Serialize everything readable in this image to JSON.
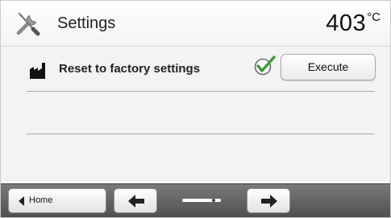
{
  "header": {
    "title": "Settings",
    "temperature_value": "403",
    "temperature_unit": "°C",
    "icon": "wrench-screwdriver-icon"
  },
  "settings_row": {
    "icon": "factory-icon",
    "label": "Reset to factory settings",
    "status_icon": "checkmark-icon",
    "execute_label": "Execute"
  },
  "footer": {
    "home_label": "Home",
    "prev_icon": "arrow-left-icon",
    "next_icon": "arrow-right-icon",
    "page_position": 0.85
  },
  "colors": {
    "check_green": "#3f9a3a",
    "footer_bg": "#5e5e5e"
  }
}
